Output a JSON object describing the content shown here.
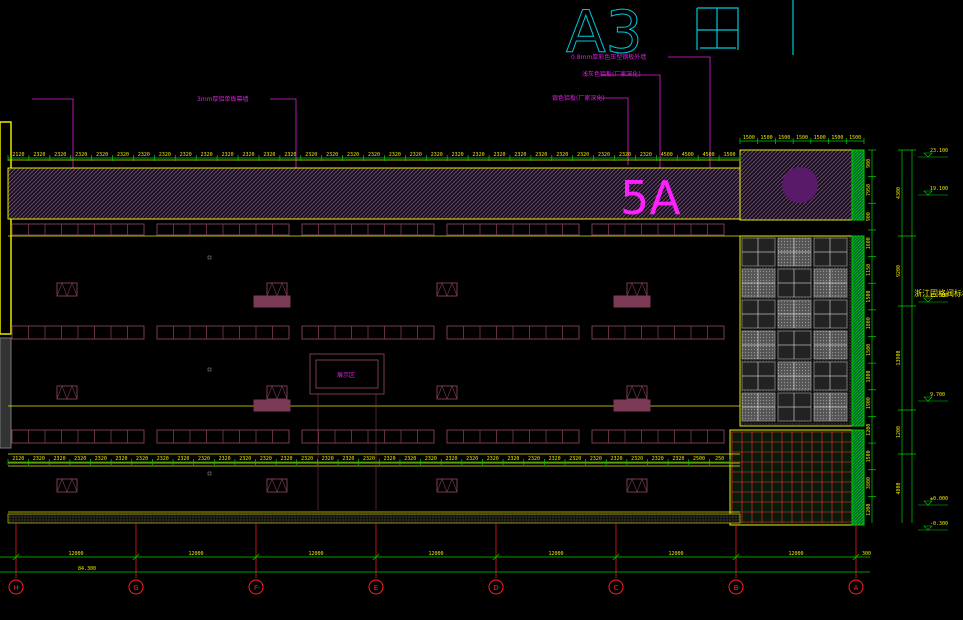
{
  "title_block": {
    "sheet_label": "A3"
  },
  "building": {
    "number_sign": "5A",
    "window_label": "展示区"
  },
  "annotations": {
    "top_left": "3mm厚铝单板幕墙",
    "center": "银色铝板(厂家深化)",
    "right_1": "0.8mm厚彩色压型钢板外墙",
    "right_2": "浅灰色铝板(厂家深化)"
  },
  "right_note": "浙江固格阀标标",
  "top_dims": [
    "2120",
    "2320",
    "2320",
    "2320",
    "2320",
    "2320",
    "2320",
    "2320",
    "2320",
    "2320",
    "2320",
    "2320",
    "2320",
    "2320",
    "2320",
    "2320",
    "2320",
    "2320",
    "2320",
    "2320",
    "2320",
    "2320",
    "2320",
    "2320",
    "2320",
    "2320",
    "2320",
    "2320",
    "2320",
    "2320",
    "2320",
    "4500",
    "4500",
    "4500",
    "1500"
  ],
  "right_top_dims": [
    "1500",
    "1500",
    "1500",
    "1500",
    "1500",
    "1500",
    "1500"
  ],
  "mid_dims": [
    "2120",
    "2320",
    "2320",
    "2320",
    "2320",
    "2320",
    "2320",
    "2320",
    "2320",
    "2320",
    "2320",
    "2320",
    "2320",
    "2320",
    "2320",
    "2320",
    "2320",
    "2320",
    "2320",
    "2320",
    "2320",
    "2320",
    "2320",
    "2320",
    "2320",
    "2320",
    "2320",
    "2320",
    "2320",
    "2320",
    "2320",
    "2320",
    "2320",
    "2500",
    "250"
  ],
  "vertical_dims": [
    "900",
    "7950",
    "900",
    "1600",
    "1150",
    "1500",
    "1800",
    "1500",
    "1800",
    "1900",
    "1200",
    "1500",
    "3800",
    "1200"
  ],
  "vertical_overall": [
    "4300",
    "9200",
    "13900",
    "1200",
    "4800"
  ],
  "elevations": [
    "23.100",
    "19.100",
    "15.300",
    "9.700",
    "±0.000",
    "-0.300"
  ],
  "bay_dims": [
    "12000",
    "12000",
    "12000",
    "12000",
    "12000",
    "12000",
    "12000"
  ],
  "overall_dim": "84.300",
  "end_dim": "300",
  "axes": [
    "H",
    "G",
    "F",
    "E",
    "D",
    "C",
    "B",
    "A"
  ],
  "colors": {
    "yellow": "#e8e800",
    "magenta": "#e020e0",
    "green": "#00d000",
    "red": "#ff2020",
    "cyan": "#00c8d8",
    "window": "#7a3a55",
    "hatch": "#9a7ab0"
  }
}
